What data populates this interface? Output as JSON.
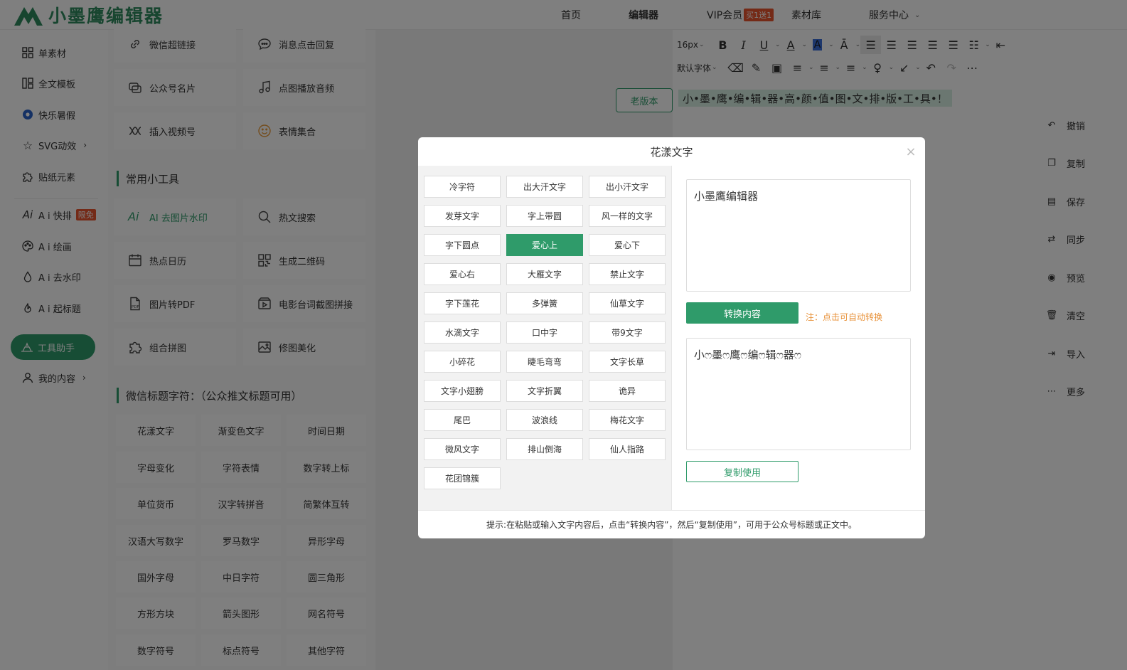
{
  "header": {
    "logo_text": "小墨鹰编辑器",
    "nav": {
      "home": "首页",
      "editor": "编辑器",
      "vip": "VIP会员",
      "vip_badge": "买1送1",
      "assets": "素材库",
      "service": "服务中心"
    }
  },
  "leftnav": {
    "single": "单素材",
    "template": "全文模板",
    "summer": "快乐暑假",
    "svg": "SVG动效",
    "sticker": "贴纸元素",
    "ai_layout": "A i 快排",
    "ai_layout_badge": "限免",
    "ai_draw": "A i 绘画",
    "ai_watermark": "A i 去水印",
    "ai_title": "A i 起标题",
    "tools": "工具助手",
    "mine": "我的内容"
  },
  "tools_top": [
    {
      "icon": "link-icon",
      "label": "微信超链接"
    },
    {
      "icon": "chat-icon",
      "label": "消息点击回复"
    },
    {
      "icon": "card-icon",
      "label": "公众号名片"
    },
    {
      "icon": "music-icon",
      "label": "点图播放音频"
    },
    {
      "icon": "video-icon",
      "label": "插入视频号"
    },
    {
      "icon": "smile-icon",
      "label": "表情集合"
    }
  ],
  "section_tools": "常用小工具",
  "tools_common": [
    {
      "icon": "ai-icon",
      "label": "AI 去图片水印"
    },
    {
      "icon": "search-icon",
      "label": "热文搜索"
    },
    {
      "icon": "calendar-icon",
      "label": "热点日历"
    },
    {
      "icon": "qrcode-icon",
      "label": "生成二维码"
    },
    {
      "icon": "pdf-icon",
      "label": "图片转PDF"
    },
    {
      "icon": "film-icon",
      "label": "电影台词截图拼接"
    },
    {
      "icon": "puzzle-icon",
      "label": "组合拼图"
    },
    {
      "icon": "image-icon",
      "label": "修图美化"
    }
  ],
  "section_wx": "微信标题字符：（公众推文标题可用）",
  "wx_tools": [
    "花漾文字",
    "渐变色文字",
    "时间日期",
    "字母变化",
    "字符表情",
    "数字转上标",
    "单位货币",
    "汉字转拼音",
    "简繁体互转",
    "汉语大写数字",
    "罗马数字",
    "异形字母",
    "国外字母",
    "中日字符",
    "圆三角形",
    "方形方块",
    "箭头图形",
    "网名符号",
    "数字符号",
    "标点符号",
    "其他字符"
  ],
  "old_version": "老版本",
  "toolbar": {
    "font_size": "16px",
    "font_family": "默认字体"
  },
  "editor_text": "小•墨•鹰•编•辑•器•高•颜•值•图•文•排•版•工•具•！",
  "rightbar": [
    "撤销",
    "复制",
    "保存",
    "同步",
    "预览",
    "清空",
    "导入",
    "更多"
  ],
  "modal": {
    "title": "花漾文字",
    "options": [
      "冷字符",
      "出大汗文字",
      "出小汗文字",
      "发芽文字",
      "字上带圆",
      "风一样的文字",
      "字下圆点",
      "爱心上",
      "爱心下",
      "爱心右",
      "大雁文字",
      "禁止文字",
      "字下莲花",
      "多弹簧",
      "仙草文字",
      "水滴文字",
      "口中字",
      "带9文字",
      "小碎花",
      "睫毛弯弯",
      "文字长草",
      "文字小翅膀",
      "文字折翼",
      "诡异",
      "尾巴",
      "波浪线",
      "梅花文字",
      "微风文字",
      "排山倒海",
      "仙人指路",
      "花团锦簇"
    ],
    "active_option": "爱心上",
    "input_text": "小墨鹰编辑器",
    "convert_label": "转换内容",
    "convert_note": "注：点击可自动转换",
    "output_text": "小ෆ墨ෆ鹰ෆ编ෆ辑ෆ器ෆ",
    "copy_label": "复制使用",
    "footer_tip": "提示:在粘贴或输入文字内容后，点击“转换内容”，然后“复制使用”，可用于公众号标题或正文中。"
  },
  "colors": {
    "brand": "#2f9b6a",
    "badge": "#e8542e",
    "note": "#e8923a"
  }
}
